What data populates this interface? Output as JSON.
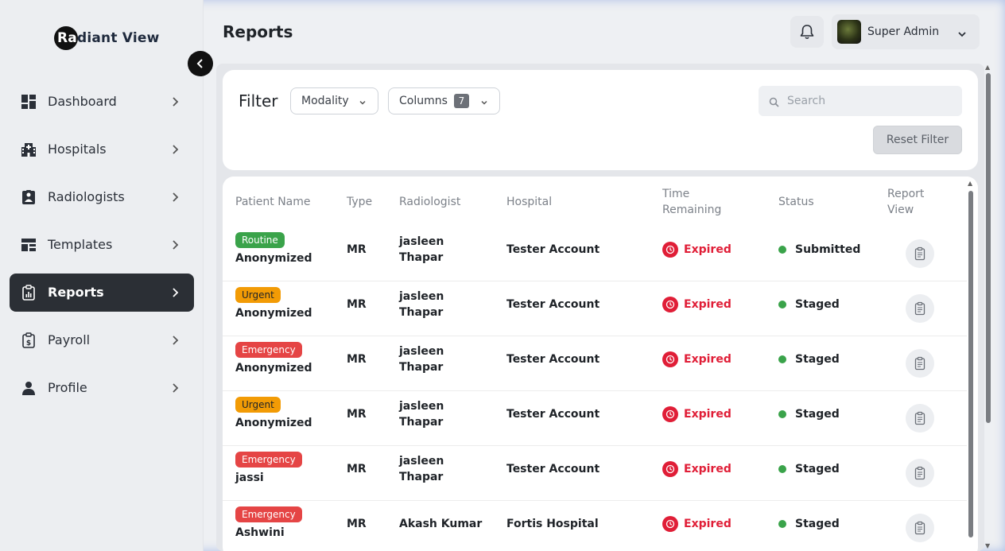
{
  "app": {
    "logo_prefix": "Ra",
    "logo_rest": "diant View"
  },
  "sidebar": {
    "items": [
      {
        "label": "Dashboard",
        "icon": "dashboard-icon",
        "active": false
      },
      {
        "label": "Hospitals",
        "icon": "hospital-icon",
        "active": false
      },
      {
        "label": "Radiologists",
        "icon": "radiologist-icon",
        "active": false
      },
      {
        "label": "Templates",
        "icon": "templates-icon",
        "active": false
      },
      {
        "label": "Reports",
        "icon": "clipboard-chart-icon",
        "active": true
      },
      {
        "label": "Payroll",
        "icon": "payroll-icon",
        "active": false
      },
      {
        "label": "Profile",
        "icon": "person-icon",
        "active": false
      }
    ]
  },
  "header": {
    "title": "Reports",
    "user_name": "Super Admin"
  },
  "filter": {
    "label": "Filter",
    "modality_label": "Modality",
    "columns_label": "Columns",
    "columns_count": "7",
    "search_placeholder": "Search",
    "search_value": "",
    "reset_label": "Reset Filter"
  },
  "table": {
    "headers": {
      "patient_name": "Patient Name",
      "type": "Type",
      "radiologist": "Radiologist",
      "hospital": "Hospital",
      "time_remaining_1": "Time",
      "time_remaining_2": "Remaining",
      "status": "Status",
      "report_view_1": "Report",
      "report_view_2": "View"
    },
    "rows": [
      {
        "priority": "Routine",
        "priority_class": "routine",
        "patient": "Anonymized",
        "type": "MR",
        "radiologist_1": "jasleen",
        "radiologist_2": "Thapar",
        "hospital": "Tester Account",
        "time": "Expired",
        "status": "Submitted"
      },
      {
        "priority": "Urgent",
        "priority_class": "urgent",
        "patient": "Anonymized",
        "type": "MR",
        "radiologist_1": "jasleen",
        "radiologist_2": "Thapar",
        "hospital": "Tester Account",
        "time": "Expired",
        "status": "Staged"
      },
      {
        "priority": "Emergency",
        "priority_class": "emergency",
        "patient": "Anonymized",
        "type": "MR",
        "radiologist_1": "jasleen",
        "radiologist_2": "Thapar",
        "hospital": "Tester Account",
        "time": "Expired",
        "status": "Staged"
      },
      {
        "priority": "Urgent",
        "priority_class": "urgent",
        "patient": "Anonymized",
        "type": "MR",
        "radiologist_1": "jasleen",
        "radiologist_2": "Thapar",
        "hospital": "Tester Account",
        "time": "Expired",
        "status": "Staged"
      },
      {
        "priority": "Emergency",
        "priority_class": "emergency",
        "patient": "jassi",
        "type": "MR",
        "radiologist_1": "jasleen",
        "radiologist_2": "Thapar",
        "hospital": "Tester Account",
        "time": "Expired",
        "status": "Staged"
      },
      {
        "priority": "Emergency",
        "priority_class": "emergency",
        "patient": "Ashwini",
        "type": "MR",
        "radiologist_1": "Akash Kumar",
        "radiologist_2": "",
        "hospital": "Fortis Hospital",
        "time": "Expired",
        "status": "Staged"
      }
    ]
  },
  "colors": {
    "routine": "#3aa34a",
    "urgent": "#f29b05",
    "emergency": "#e54545",
    "expired": "#e01e37",
    "status_dot": "#3aa34a",
    "active_nav": "#2b2f35"
  }
}
